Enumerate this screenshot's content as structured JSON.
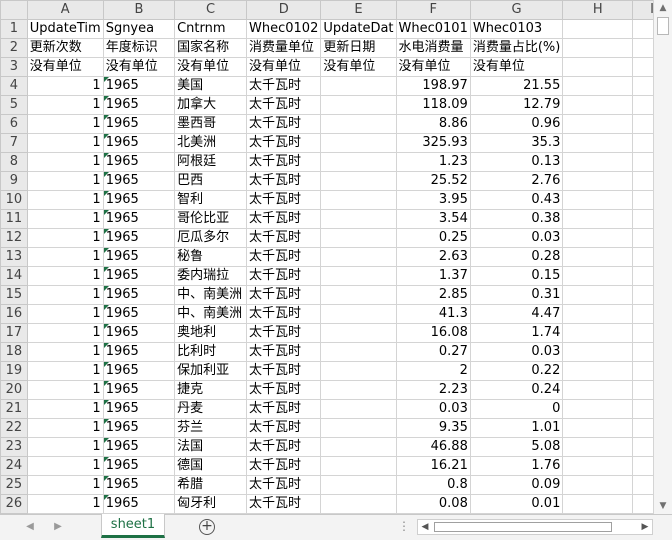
{
  "columns": [
    "A",
    "B",
    "C",
    "D",
    "E",
    "F",
    "G",
    "H",
    "I"
  ],
  "rows": [
    {
      "n": "1",
      "cells": [
        "UpdateTim",
        "Sgnyea",
        "Cntrnm",
        "Whec0102",
        "UpdateDat",
        "Whec0101",
        "Whec0103",
        "",
        ""
      ]
    },
    {
      "n": "2",
      "cells": [
        "更新次数",
        "年度标识",
        "国家名称",
        "消费量单位",
        "更新日期",
        "水电消费量",
        "消费量占比(%)",
        "",
        ""
      ]
    },
    {
      "n": "3",
      "cells": [
        "没有单位",
        "没有单位",
        "没有单位",
        "没有单位",
        "没有单位",
        "没有单位",
        "没有单位",
        "",
        ""
      ]
    },
    {
      "n": "4",
      "cells": [
        "1",
        "1965",
        "美国",
        "太千瓦时",
        "",
        "198.97",
        "21.55",
        "",
        ""
      ]
    },
    {
      "n": "5",
      "cells": [
        "1",
        "1965",
        "加拿大",
        "太千瓦时",
        "",
        "118.09",
        "12.79",
        "",
        ""
      ]
    },
    {
      "n": "6",
      "cells": [
        "1",
        "1965",
        "墨西哥",
        "太千瓦时",
        "",
        "8.86",
        "0.96",
        "",
        ""
      ]
    },
    {
      "n": "7",
      "cells": [
        "1",
        "1965",
        "北美洲",
        "太千瓦时",
        "",
        "325.93",
        "35.3",
        "",
        ""
      ]
    },
    {
      "n": "8",
      "cells": [
        "1",
        "1965",
        "阿根廷",
        "太千瓦时",
        "",
        "1.23",
        "0.13",
        "",
        ""
      ]
    },
    {
      "n": "9",
      "cells": [
        "1",
        "1965",
        "巴西",
        "太千瓦时",
        "",
        "25.52",
        "2.76",
        "",
        ""
      ]
    },
    {
      "n": "10",
      "cells": [
        "1",
        "1965",
        "智利",
        "太千瓦时",
        "",
        "3.95",
        "0.43",
        "",
        ""
      ]
    },
    {
      "n": "11",
      "cells": [
        "1",
        "1965",
        "哥伦比亚",
        "太千瓦时",
        "",
        "3.54",
        "0.38",
        "",
        ""
      ]
    },
    {
      "n": "12",
      "cells": [
        "1",
        "1965",
        "厄瓜多尔",
        "太千瓦时",
        "",
        "0.25",
        "0.03",
        "",
        ""
      ]
    },
    {
      "n": "13",
      "cells": [
        "1",
        "1965",
        "秘鲁",
        "太千瓦时",
        "",
        "2.63",
        "0.28",
        "",
        ""
      ]
    },
    {
      "n": "14",
      "cells": [
        "1",
        "1965",
        "委内瑞拉",
        "太千瓦时",
        "",
        "1.37",
        "0.15",
        "",
        ""
      ]
    },
    {
      "n": "15",
      "cells": [
        "1",
        "1965",
        "中、南美洲",
        "太千瓦时",
        "",
        "2.85",
        "0.31",
        "",
        ""
      ]
    },
    {
      "n": "16",
      "cells": [
        "1",
        "1965",
        "中、南美洲",
        "太千瓦时",
        "",
        "41.3",
        "4.47",
        "",
        ""
      ]
    },
    {
      "n": "17",
      "cells": [
        "1",
        "1965",
        "奥地利",
        "太千瓦时",
        "",
        "16.08",
        "1.74",
        "",
        ""
      ]
    },
    {
      "n": "18",
      "cells": [
        "1",
        "1965",
        "比利时",
        "太千瓦时",
        "",
        "0.27",
        "0.03",
        "",
        ""
      ]
    },
    {
      "n": "19",
      "cells": [
        "1",
        "1965",
        "保加利亚",
        "太千瓦时",
        "",
        "2",
        "0.22",
        "",
        ""
      ]
    },
    {
      "n": "20",
      "cells": [
        "1",
        "1965",
        "捷克",
        "太千瓦时",
        "",
        "2.23",
        "0.24",
        "",
        ""
      ]
    },
    {
      "n": "21",
      "cells": [
        "1",
        "1965",
        "丹麦",
        "太千瓦时",
        "",
        "0.03",
        "0",
        "",
        ""
      ]
    },
    {
      "n": "22",
      "cells": [
        "1",
        "1965",
        "芬兰",
        "太千瓦时",
        "",
        "9.35",
        "1.01",
        "",
        ""
      ]
    },
    {
      "n": "23",
      "cells": [
        "1",
        "1965",
        "法国",
        "太千瓦时",
        "",
        "46.88",
        "5.08",
        "",
        ""
      ]
    },
    {
      "n": "24",
      "cells": [
        "1",
        "1965",
        "德国",
        "太千瓦时",
        "",
        "16.21",
        "1.76",
        "",
        ""
      ]
    },
    {
      "n": "25",
      "cells": [
        "1",
        "1965",
        "希腊",
        "太千瓦时",
        "",
        "0.8",
        "0.09",
        "",
        ""
      ]
    },
    {
      "n": "26",
      "cells": [
        "1",
        "1965",
        "匈牙利",
        "太千瓦时",
        "",
        "0.08",
        "0.01",
        "",
        ""
      ]
    }
  ],
  "sheet_tab": "sheet1",
  "add_sheet_symbol": "+",
  "colors": {
    "accent": "#1e7145",
    "header_bg": "#e9e9e9",
    "grid_line": "#d4d4d4"
  }
}
